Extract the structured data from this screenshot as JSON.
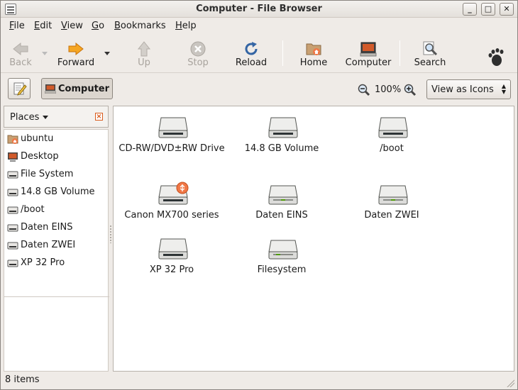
{
  "window": {
    "title": "Computer - File Browser",
    "controls": {
      "minimize": "_",
      "maximize": "□",
      "close": "✕"
    }
  },
  "menu": [
    {
      "label": "File",
      "u": "F",
      "rest": "ile"
    },
    {
      "label": "Edit",
      "u": "E",
      "rest": "dit"
    },
    {
      "label": "View",
      "u": "V",
      "rest": "iew"
    },
    {
      "label": "Go",
      "u": "G",
      "rest": "o"
    },
    {
      "label": "Bookmarks",
      "u": "B",
      "rest": "ookmarks"
    },
    {
      "label": "Help",
      "u": "H",
      "rest": "elp"
    }
  ],
  "toolbar": {
    "back": "Back",
    "forward": "Forward",
    "up": "Up",
    "stop": "Stop",
    "reload": "Reload",
    "home": "Home",
    "computer": "Computer",
    "search": "Search"
  },
  "location": {
    "path_button": "Computer",
    "zoom_level": "100%",
    "view_mode": "View as Icons"
  },
  "sidebar": {
    "header": "Places",
    "items": [
      {
        "label": "ubuntu",
        "icon": "home-folder-icon"
      },
      {
        "label": "Desktop",
        "icon": "desktop-icon"
      },
      {
        "label": "File System",
        "icon": "drive-icon"
      },
      {
        "label": "14.8 GB Volume",
        "icon": "drive-icon"
      },
      {
        "label": "/boot",
        "icon": "drive-icon"
      },
      {
        "label": "Daten EINS",
        "icon": "drive-icon"
      },
      {
        "label": "Daten ZWEI",
        "icon": "drive-icon"
      },
      {
        "label": "XP 32 Pro",
        "icon": "drive-icon"
      }
    ]
  },
  "items": [
    {
      "label": "CD-RW/DVD±RW Drive",
      "icon": "optical-drive-icon"
    },
    {
      "label": "14.8 GB Volume",
      "icon": "drive-icon"
    },
    {
      "label": "/boot",
      "icon": "drive-icon"
    },
    {
      "label": "Canon MX700 series",
      "icon": "usb-drive-icon"
    },
    {
      "label": "Daten EINS",
      "icon": "drive-green-led-icon"
    },
    {
      "label": "Daten ZWEI",
      "icon": "drive-green-led-icon"
    },
    {
      "label": "XP 32 Pro",
      "icon": "drive-icon"
    },
    {
      "label": "Filesystem",
      "icon": "drive-green-led-icon"
    }
  ],
  "status": {
    "text": "8 items"
  },
  "colors": {
    "accent": "#f07746",
    "window_bg": "#efebe7",
    "reload_blue": "#3465a4"
  }
}
